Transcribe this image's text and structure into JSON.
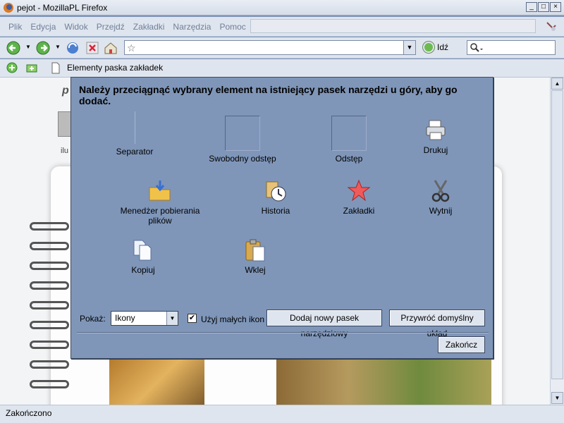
{
  "window": {
    "title": "pejot - MozillaPL Firefox"
  },
  "menu": [
    "Plik",
    "Edycja",
    "Widok",
    "Przejdź",
    "Zakładki",
    "Narzędzia",
    "Pomoc"
  ],
  "nav": {
    "go_label": "Idź"
  },
  "bookmarks": {
    "toolbar_item": "Elementy paska zakładek"
  },
  "page": {
    "heading_fragment": "p",
    "text_fragment": "ilu"
  },
  "dialog": {
    "instruction": "Należy przeciągnąć wybrany element na istniejący pasek narzędzi u góry, aby go dodać.",
    "items": [
      {
        "label": "Separator",
        "icon": "separator-icon"
      },
      {
        "label": "Swobodny odstęp",
        "icon": "flexible-space-icon"
      },
      {
        "label": "Odstęp",
        "icon": "space-icon"
      },
      {
        "label": "Drukuj",
        "icon": "printer-icon"
      },
      {
        "label": "Menedżer pobierania plików",
        "icon": "download-folder-icon"
      },
      {
        "label": "Historia",
        "icon": "history-clock-icon"
      },
      {
        "label": "Zakładki",
        "icon": "bookmark-star-icon"
      },
      {
        "label": "Wytnij",
        "icon": "scissors-icon"
      },
      {
        "label": "Kopiuj",
        "icon": "copy-icon"
      },
      {
        "label": "Wklej",
        "icon": "paste-icon"
      }
    ],
    "show_label": "Pokaż:",
    "show_value": "Ikony",
    "small_icons_label": "Użyj małych ikon",
    "small_icons_checked": true,
    "add_toolbar_button": "Dodaj nowy pasek narzędziowy",
    "restore_button": "Przywróć domyślny układ",
    "finish_button": "Zakończ"
  },
  "status": {
    "text": "Zakończono"
  }
}
